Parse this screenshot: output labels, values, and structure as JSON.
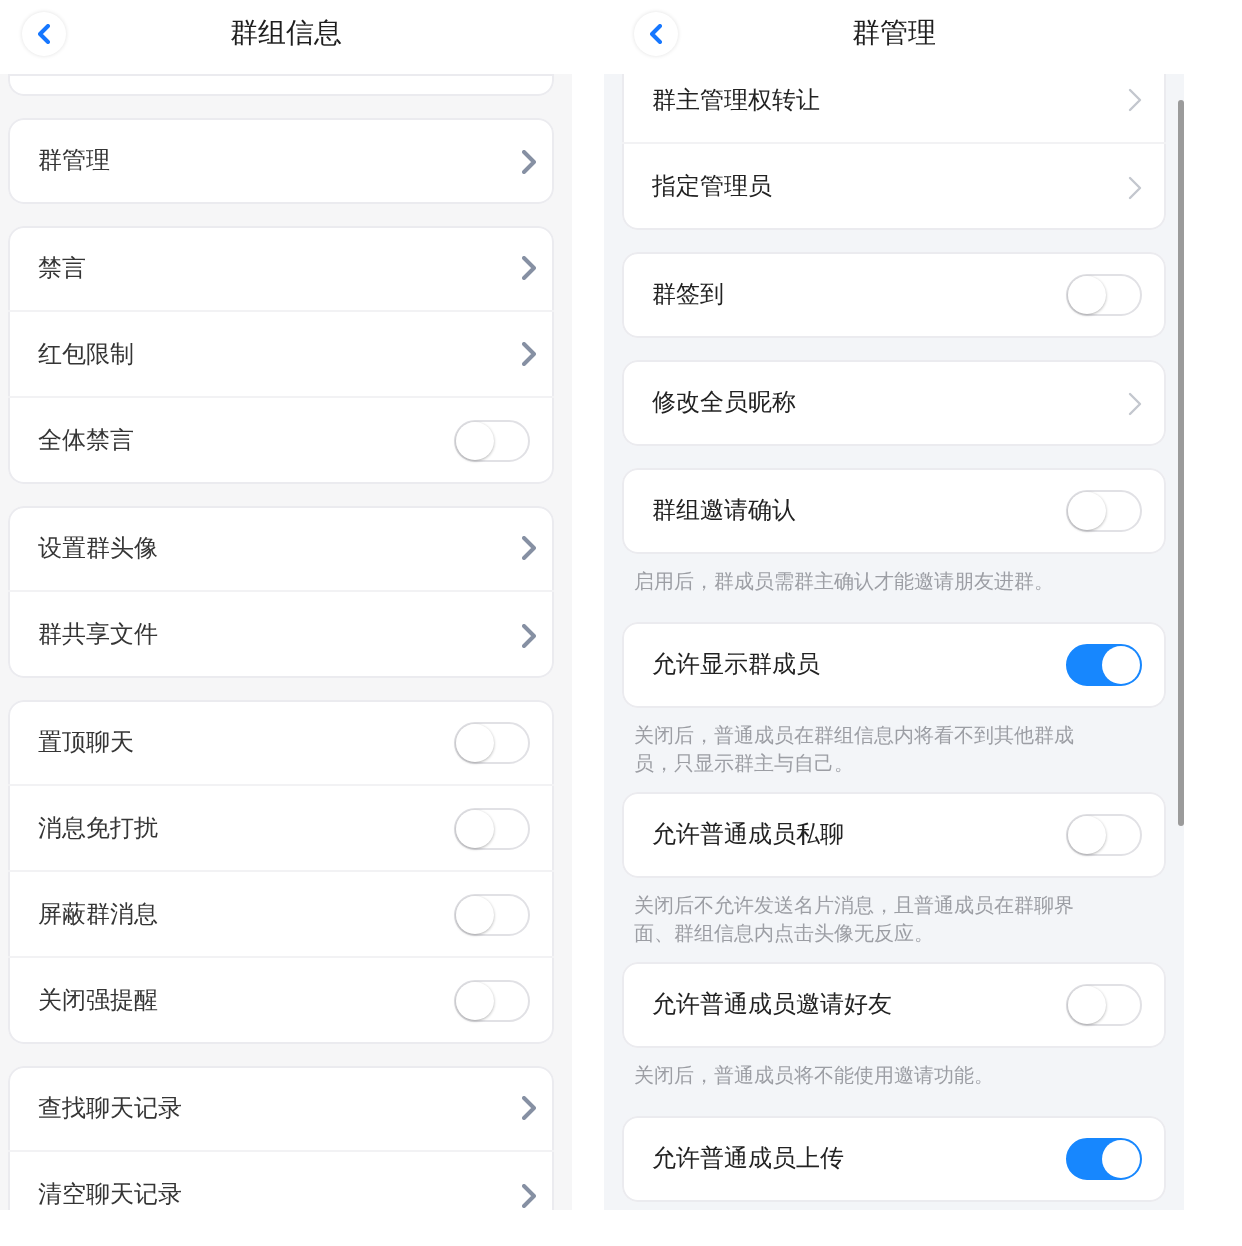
{
  "screens": [
    {
      "header": {
        "title": "群组信息"
      },
      "sections": [
        {
          "kind": "stub"
        },
        {
          "kind": "group",
          "items": [
            {
              "kind": "link",
              "label": "群管理"
            }
          ]
        },
        {
          "kind": "group",
          "items": [
            {
              "kind": "link",
              "label": "禁言"
            },
            {
              "kind": "link",
              "label": "红包限制"
            },
            {
              "kind": "toggle",
              "label": "全体禁言",
              "on": false
            }
          ]
        },
        {
          "kind": "group",
          "items": [
            {
              "kind": "link",
              "label": "设置群头像"
            },
            {
              "kind": "link",
              "label": "群共享文件"
            }
          ]
        },
        {
          "kind": "group",
          "items": [
            {
              "kind": "toggle",
              "label": "置顶聊天",
              "on": false
            },
            {
              "kind": "toggle",
              "label": "消息免打扰",
              "on": false
            },
            {
              "kind": "toggle",
              "label": "屏蔽群消息",
              "on": false
            },
            {
              "kind": "toggle",
              "label": "关闭强提醒",
              "on": false
            }
          ]
        },
        {
          "kind": "group",
          "items": [
            {
              "kind": "link",
              "label": "查找聊天记录"
            },
            {
              "kind": "link",
              "label": "清空聊天记录"
            }
          ]
        }
      ]
    },
    {
      "header": {
        "title": "群管理"
      },
      "sections": [
        {
          "kind": "group",
          "items": [
            {
              "kind": "link",
              "label": "群主管理权转让"
            },
            {
              "kind": "link",
              "label": "指定管理员"
            }
          ]
        },
        {
          "kind": "group",
          "items": [
            {
              "kind": "toggle",
              "label": "群签到",
              "on": false
            }
          ]
        },
        {
          "kind": "group",
          "items": [
            {
              "kind": "link",
              "label": "修改全员昵称"
            }
          ]
        },
        {
          "kind": "group",
          "items": [
            {
              "kind": "toggle",
              "label": "群组邀请确认",
              "on": false
            }
          ],
          "note": "启用后，群成员需群主确认才能邀请朋友进群。"
        },
        {
          "kind": "group",
          "items": [
            {
              "kind": "toggle",
              "label": "允许显示群成员",
              "on": true
            }
          ],
          "note": "关闭后，普通成员在群组信息内将看不到其他群成员，只显示群主与自己。"
        },
        {
          "kind": "group",
          "items": [
            {
              "kind": "toggle",
              "label": "允许普通成员私聊",
              "on": false
            }
          ],
          "note": "关闭后不允许发送名片消息，且普通成员在群聊界面、群组信息内点击头像无反应。"
        },
        {
          "kind": "group",
          "items": [
            {
              "kind": "toggle",
              "label": "允许普通成员邀请好友",
              "on": false
            }
          ],
          "note": "关闭后，普通成员将不能使用邀请功能。"
        },
        {
          "kind": "group",
          "items": [
            {
              "kind": "toggle",
              "label": "允许普通成员上传",
              "on": true
            }
          ]
        }
      ]
    }
  ]
}
